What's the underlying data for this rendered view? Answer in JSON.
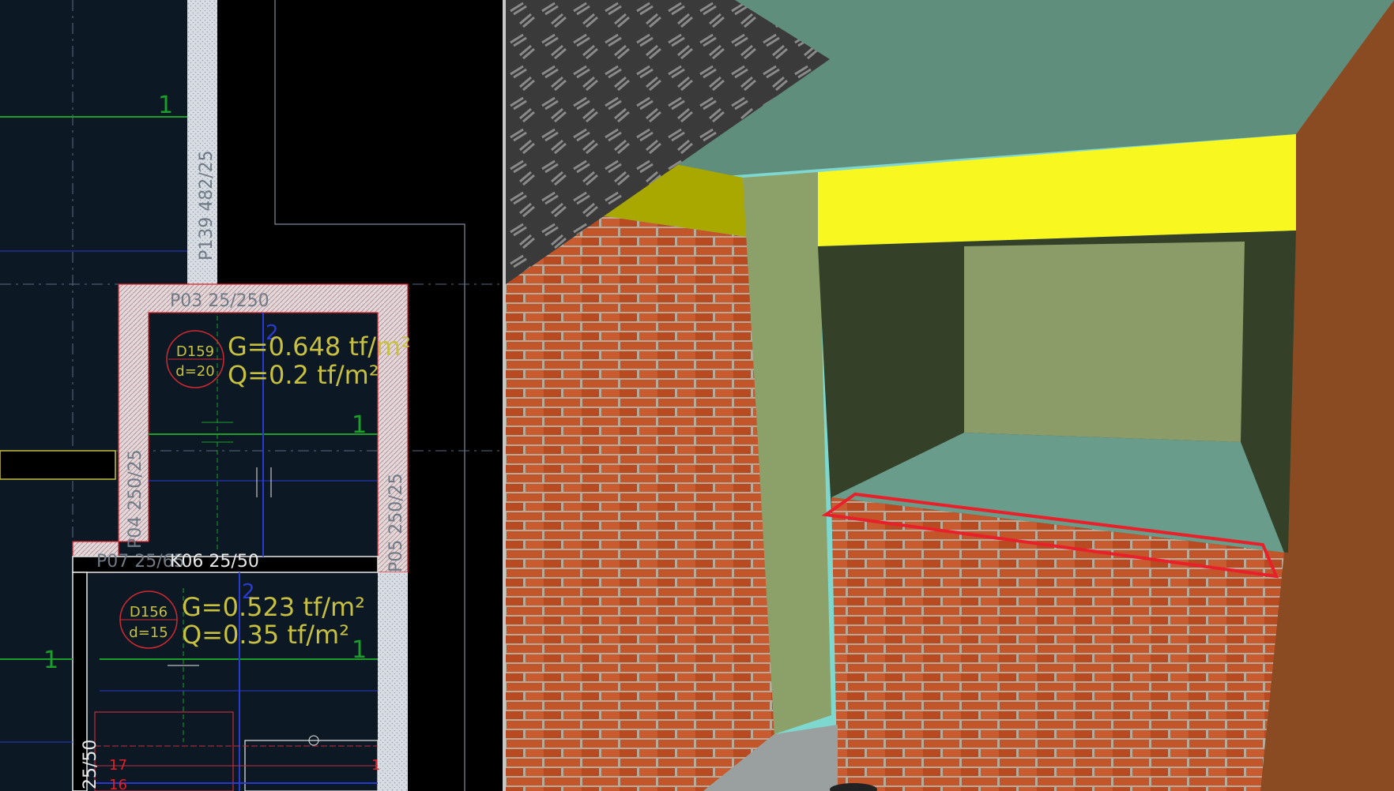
{
  "plan": {
    "axis_labels": {
      "a1": "1",
      "a2": "1",
      "a3": "1",
      "a4": "1",
      "b1": "2",
      "b2": "2"
    },
    "members": {
      "p139": "P139 482/25",
      "p03": "P03 25/250",
      "p04": "P04 250/25",
      "p05": "P05 250/25",
      "p07": "P07 25/65",
      "k06": "K06 25/50",
      "beam_vert": "25/50"
    },
    "slab_d159": {
      "id": "D159",
      "thickness": "d=20",
      "g_load": "G=0.648 tf/m²",
      "q_load": "Q=0.2 tf/m²"
    },
    "slab_d156": {
      "id": "D156",
      "thickness": "d=15",
      "g_load": "G=0.523 tf/m²",
      "q_load": "Q=0.35 tf/m²"
    },
    "row_numbers": {
      "r17": "17",
      "r16": "16"
    },
    "colors": {
      "background": "#0c1824",
      "wall_hatch": "#d7dde3",
      "text_load": "#c8c040",
      "selection": "#e0202a"
    }
  },
  "model": {
    "colors": {
      "slab": "#5f8e7c",
      "column": "#8ca06a",
      "beam": "#f8f820",
      "brick": "#c2552a",
      "side_wall": "#8a4a22",
      "selection": "#e8202a"
    }
  }
}
